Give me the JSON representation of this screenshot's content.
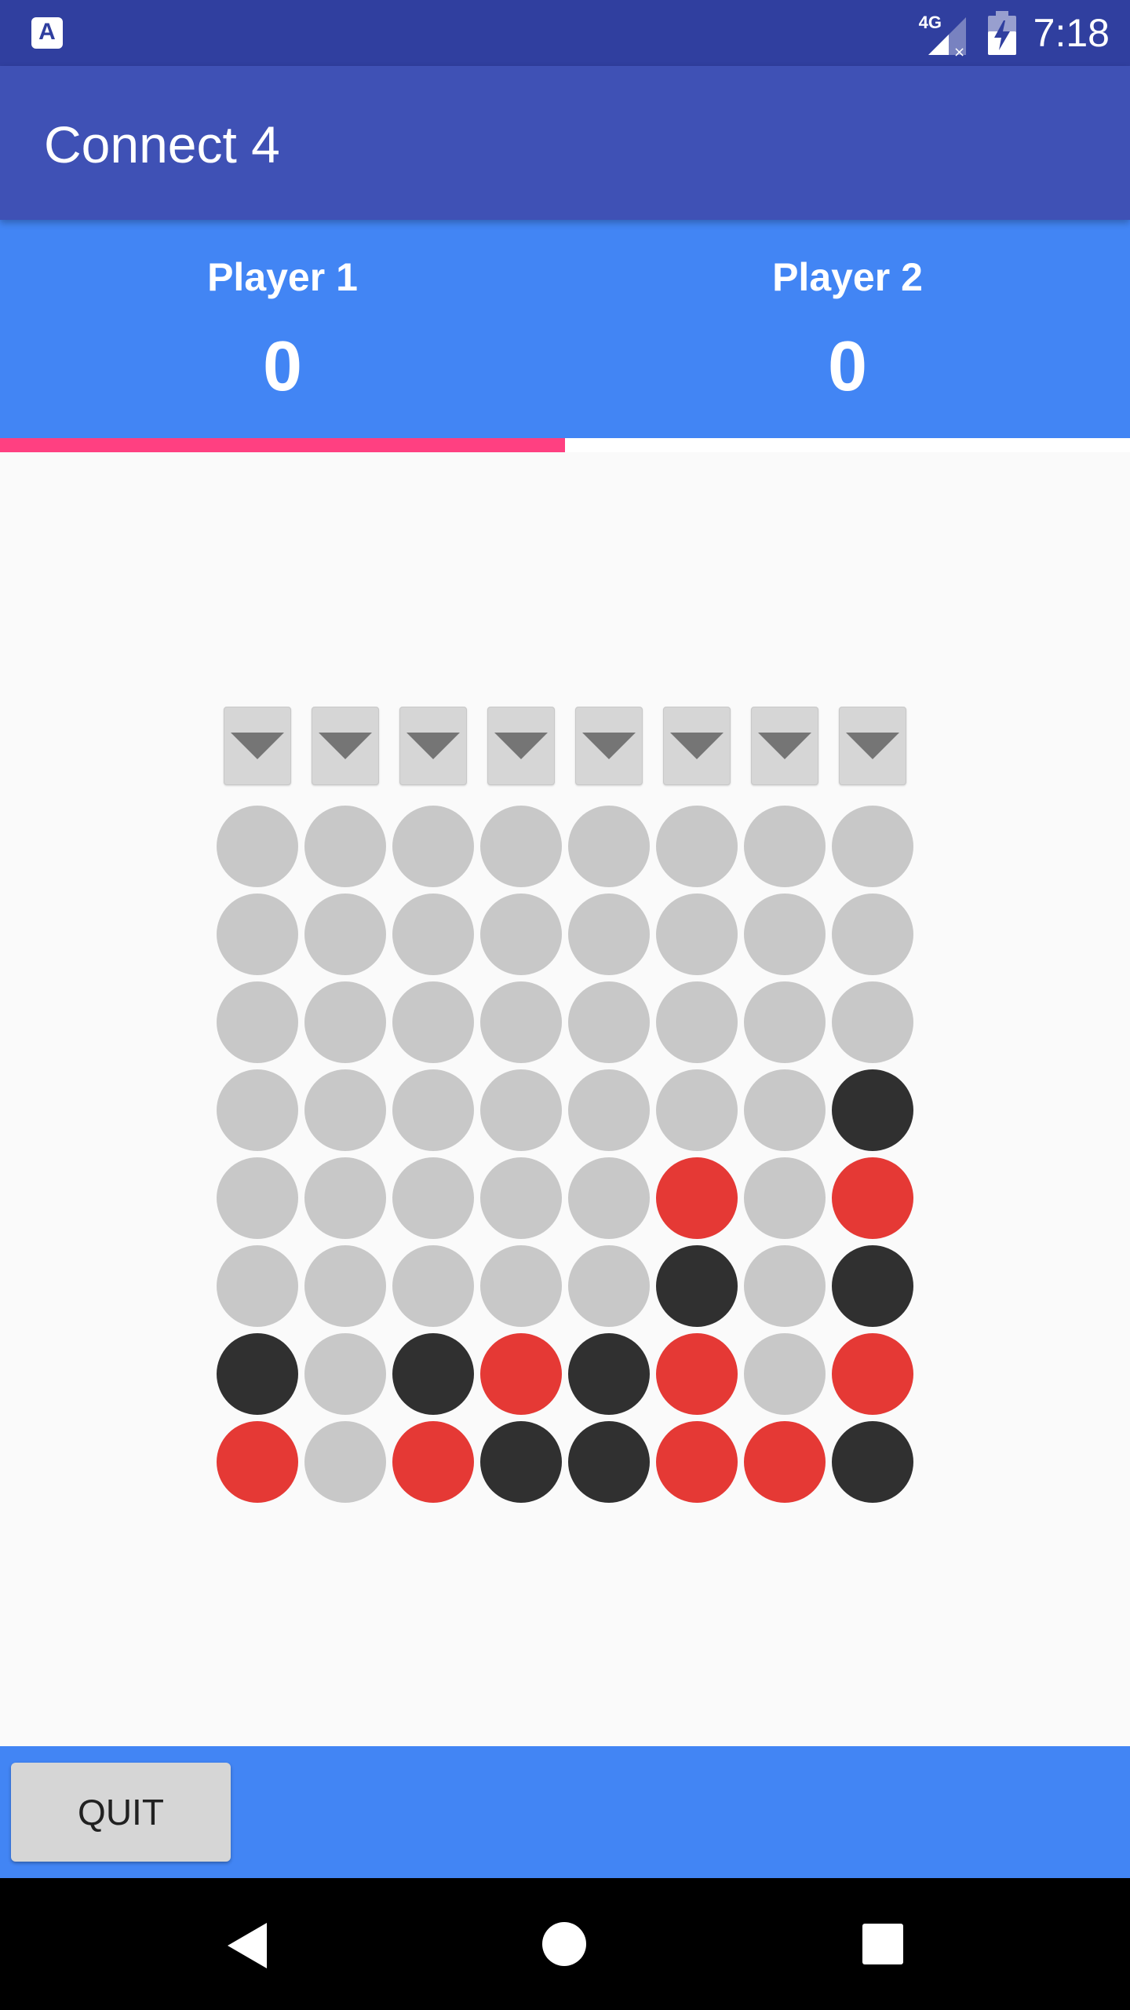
{
  "status_bar": {
    "app_icon_label": "A",
    "network_label": "4G",
    "time": "7:18",
    "icons": [
      "notification-app-icon",
      "signal-icon",
      "battery-charging-icon"
    ]
  },
  "app_bar": {
    "title": "Connect 4"
  },
  "scoreboard": {
    "players": [
      {
        "name": "Player 1",
        "score": "0"
      },
      {
        "name": "Player 2",
        "score": "0"
      }
    ],
    "active_player": 1,
    "turn_indicator_fraction": 0.5
  },
  "board": {
    "columns": 8,
    "rows": 8,
    "drop_button_icon": "arrow-down-icon",
    "cells": [
      [
        "empty",
        "empty",
        "empty",
        "empty",
        "empty",
        "empty",
        "empty",
        "empty"
      ],
      [
        "empty",
        "empty",
        "empty",
        "empty",
        "empty",
        "empty",
        "empty",
        "empty"
      ],
      [
        "empty",
        "empty",
        "empty",
        "empty",
        "empty",
        "empty",
        "empty",
        "empty"
      ],
      [
        "empty",
        "empty",
        "empty",
        "empty",
        "empty",
        "empty",
        "empty",
        "black"
      ],
      [
        "empty",
        "empty",
        "empty",
        "empty",
        "empty",
        "red",
        "empty",
        "red"
      ],
      [
        "empty",
        "empty",
        "empty",
        "empty",
        "empty",
        "black",
        "empty",
        "black"
      ],
      [
        "black",
        "empty",
        "black",
        "red",
        "black",
        "red",
        "empty",
        "red"
      ],
      [
        "red",
        "empty",
        "red",
        "black",
        "black",
        "red",
        "red",
        "black"
      ]
    ],
    "colors": {
      "empty": "#c8c8c8",
      "red": "#e53935",
      "black": "#303030"
    }
  },
  "bottom_bar": {
    "quit_label": "QUIT"
  },
  "nav_bar": {
    "icons": [
      "back-icon",
      "home-icon",
      "recents-icon"
    ]
  },
  "theme": {
    "status_bar": "#303f9f",
    "app_bar": "#3f51b5",
    "score_bar": "#4285f4",
    "accent": "#ff4081"
  }
}
